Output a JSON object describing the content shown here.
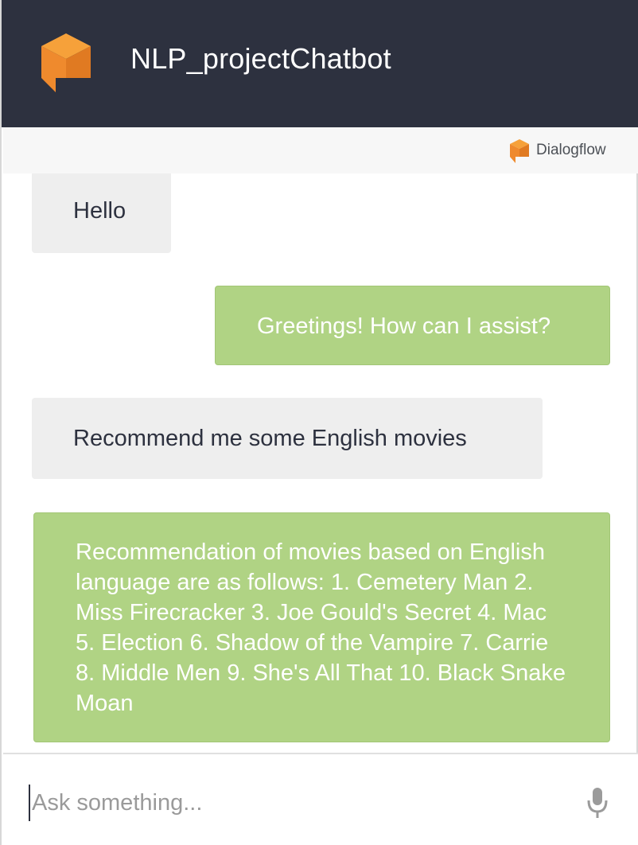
{
  "header": {
    "title": "NLP_projectChatbot"
  },
  "powered_by": {
    "label": "Dialogflow"
  },
  "messages": [
    {
      "sender": "user",
      "text": "Hello"
    },
    {
      "sender": "bot",
      "text": "Greetings! How can I assist?"
    },
    {
      "sender": "user",
      "text": "Recommend me some English movies"
    },
    {
      "sender": "bot",
      "text": "Recommendation of movies based on English language are as follows: 1. Cemetery Man 2. Miss Firecracker 3. Joe Gould's Secret 4. Mac 5. Election 6. Shadow of the Vampire 7. Carrie 8. Middle Men 9. She's All That 10. Black Snake Moan"
    }
  ],
  "composer": {
    "placeholder": "Ask something...",
    "value": ""
  },
  "icons": {
    "bot_logo": "dialogflow-cube-chat-icon",
    "powered_logo": "dialogflow-cube-icon",
    "mic": "microphone-icon"
  },
  "colors": {
    "header_bg": "#2d313f",
    "logo_orange": "#ef8a2d",
    "user_bubble": "#eeeeee",
    "bot_bubble": "#b0d384"
  }
}
